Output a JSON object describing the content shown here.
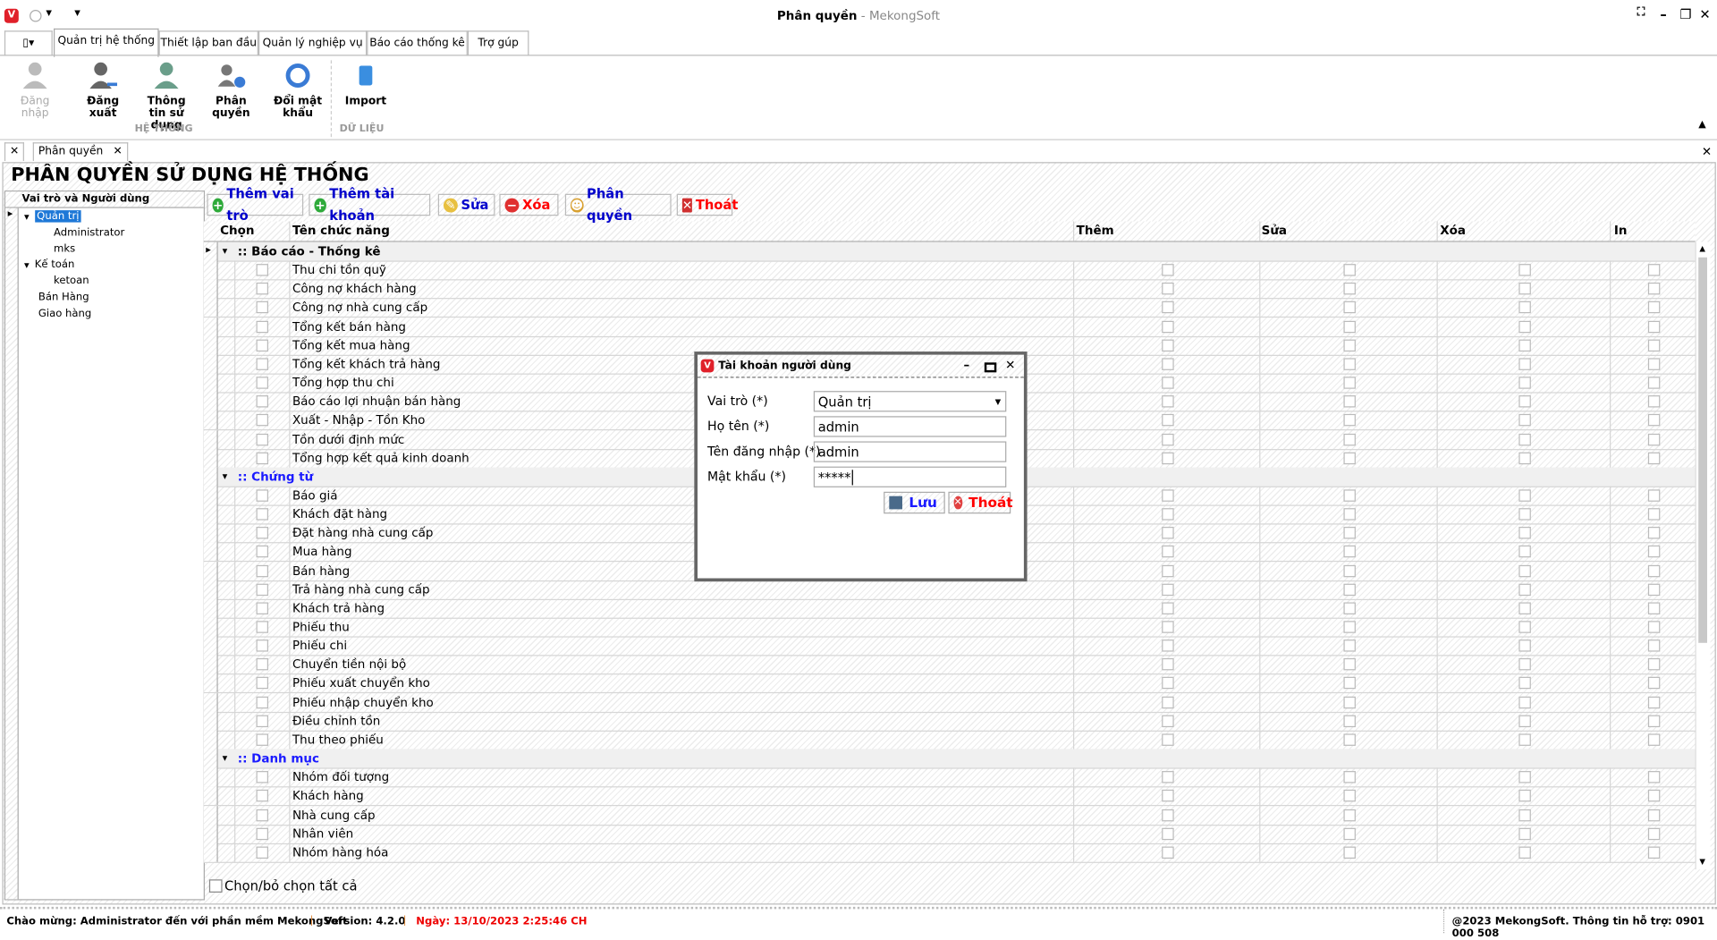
{
  "window": {
    "title": "Phân quyền",
    "title_sub": " - MekongSoft",
    "minimize": "–",
    "restore": "❐",
    "close": "✕",
    "fullscreen": "⛶"
  },
  "ribbon_tabs": [
    "Quản trị hệ thống",
    "Thiết lập ban đầu",
    "Quản lý nghiệp vụ",
    "Báo cáo thống kê",
    "Trợ gúp"
  ],
  "ribbon": {
    "buttons": [
      {
        "label": "Đăng nhập",
        "icon": "login-icon",
        "disabled": true
      },
      {
        "label": "Đăng xuất",
        "icon": "logout-icon"
      },
      {
        "label": "Thông tin sử dụng",
        "icon": "user-info-icon"
      },
      {
        "label": "Phân quyền",
        "icon": "permission-icon"
      },
      {
        "label": "Đổi mật khẩu",
        "icon": "refresh-icon"
      },
      {
        "label": "Import",
        "icon": "database-icon"
      }
    ],
    "groups": [
      "HỆ THỐNG",
      "DỮ LIỆU"
    ]
  },
  "doc_tab": {
    "close_all": "✕",
    "label": "Phân quyền",
    "close": "✕"
  },
  "page_title": "PHÂN QUYỀN SỬ DỤNG HỆ THỐNG",
  "tree": {
    "header": "Vai trò và Người dùng",
    "items": [
      {
        "label": "Quản trị",
        "level": 0,
        "expanded": true,
        "selected": true
      },
      {
        "label": "Administrator",
        "level": 1
      },
      {
        "label": "mks",
        "level": 1
      },
      {
        "label": "Kế toán",
        "level": 0,
        "expanded": true
      },
      {
        "label": "ketoan",
        "level": 1
      },
      {
        "label": "Bán Hàng",
        "level": 0
      },
      {
        "label": "Giao hàng",
        "level": 0
      }
    ]
  },
  "toolbar": [
    {
      "label": "Thêm vai trò",
      "icon": "add-icon",
      "color": "#0000cc"
    },
    {
      "label": "Thêm tài khoản",
      "icon": "add-icon",
      "color": "#0000cc"
    },
    {
      "label": "Sửa",
      "icon": "edit-icon",
      "color": "#0000cc"
    },
    {
      "label": "Xóa",
      "icon": "delete-icon",
      "color": "#ff0000"
    },
    {
      "label": "Phân quyền",
      "icon": "users-icon",
      "color": "#0000cc"
    },
    {
      "label": "Thoát",
      "icon": "exit-icon",
      "color": "#ff0000"
    }
  ],
  "grid": {
    "columns": [
      "Chọn",
      "Tên chức năng",
      "Thêm",
      "Sửa",
      "Xóa",
      "In"
    ],
    "groups": [
      {
        "title": ":: Báo cáo - Thống kê",
        "items": [
          "Thu chi tồn quỹ",
          "Công nợ khách hàng",
          "Công nợ nhà cung cấp",
          "Tổng kết bán hàng",
          "Tổng kết mua hàng",
          "Tổng kết khách trả hàng",
          "Tổng hợp thu chi",
          "Báo cáo lợi nhuận bán hàng",
          "Xuất - Nhập - Tồn Kho",
          "Tồn dưới định mức",
          "Tổng hợp kết quả kinh doanh"
        ]
      },
      {
        "title": ":: Chứng từ",
        "items": [
          "Báo giá",
          "Khách đặt hàng",
          "Đặt hàng nhà cung cấp",
          "Mua hàng",
          "Bán hàng",
          "Trả hàng nhà cung cấp",
          "Khách trả hàng",
          "Phiếu thu",
          "Phiếu chi",
          "Chuyển tiền nội bộ",
          "Phiếu xuất chuyển kho",
          "Phiếu nhập chuyển kho",
          "Điều chỉnh tồn",
          "Thu theo phiếu"
        ]
      },
      {
        "title": ":: Danh mục",
        "items": [
          "Nhóm đối tượng",
          "Khách hàng",
          "Nhà cung cấp",
          "Nhân viên",
          "Nhóm hàng hóa"
        ]
      }
    ],
    "select_all": "Chọn/bỏ chọn tất cả"
  },
  "dialog": {
    "title": "Tài khoản người dùng",
    "fields": [
      {
        "label": "Vai trò (*)",
        "value": "Quản trị"
      },
      {
        "label": "Họ tên (*)",
        "value": "admin"
      },
      {
        "label": "Tên đăng nhập (*)",
        "value": "admin"
      },
      {
        "label": "Mật khẩu (*)",
        "value": "*****"
      }
    ],
    "save": "Lưu",
    "exit": "Thoát"
  },
  "status": {
    "welcome": "Chào mừng: Administrator đến với phần mềm MekongSoft",
    "version": "Version: 4.2.0",
    "date": "Ngày: 13/10/2023 2:25:46 CH",
    "copyright": "@2023 MekongSoft. Thông tin hỗ trợ: 0901 000 508"
  }
}
